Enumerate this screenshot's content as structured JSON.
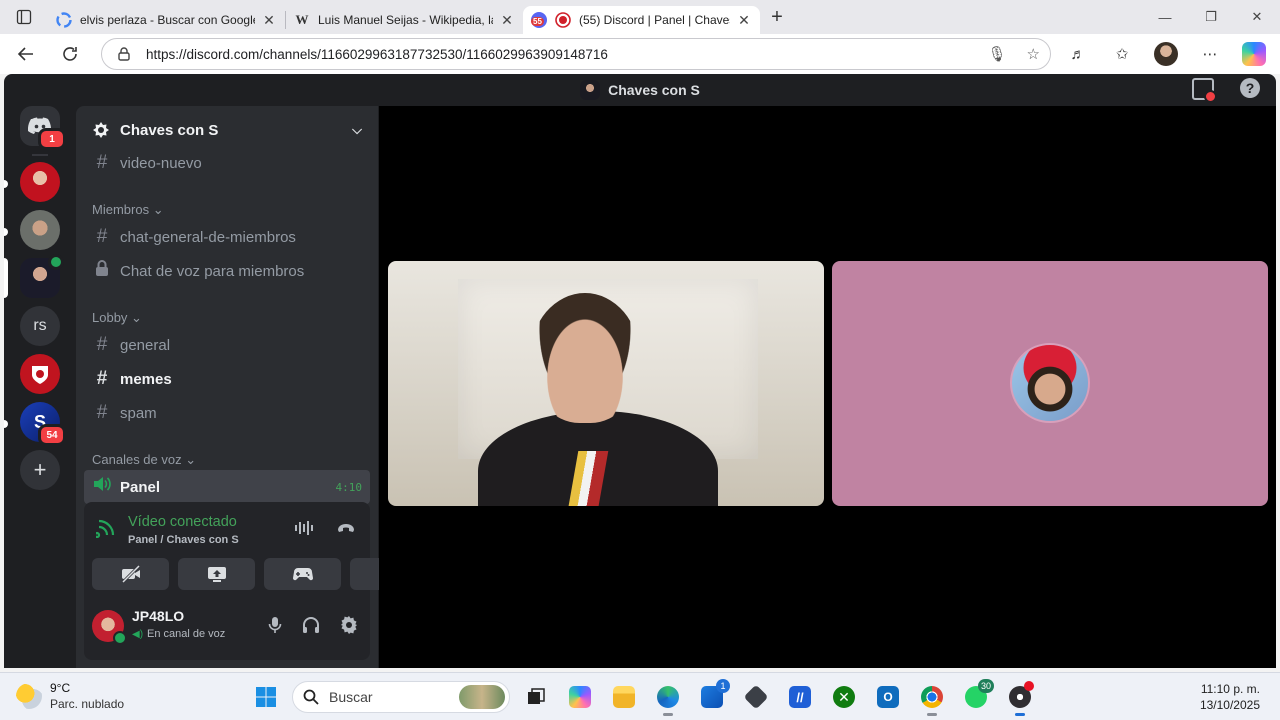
{
  "browser": {
    "tabs": [
      {
        "title": "elvis perlaza - Buscar con Google",
        "favicon": "google-icon",
        "active": false
      },
      {
        "title": "Luis Manuel Seijas - Wikipedia, la",
        "favicon": "wikipedia-icon",
        "active": false
      },
      {
        "title": "(55) Discord | Panel | Chaves",
        "favicon": "discord-icon",
        "badge": "55",
        "recording": true,
        "active": true
      }
    ],
    "url": "https://discord.com/channels/1166029963187732530/1166029963909148716"
  },
  "discord": {
    "window_title": "Chaves con S",
    "rail": {
      "home_badge": "1",
      "text_server_label": "rs",
      "server_badge": "54"
    },
    "server": {
      "name": "Chaves con S"
    },
    "channels": {
      "top": {
        "name": "video-nuevo"
      },
      "categories": [
        {
          "name": "Miembros",
          "items": [
            {
              "name": "chat-general-de-miembros",
              "type": "text"
            },
            {
              "name": "Chat de voz para miembros",
              "type": "locked-voice"
            }
          ]
        },
        {
          "name": "Lobby",
          "items": [
            {
              "name": "general",
              "type": "text"
            },
            {
              "name": "memes",
              "type": "text",
              "unread": true
            },
            {
              "name": "spam",
              "type": "text"
            }
          ]
        },
        {
          "name": "Canales de voz",
          "items": [
            {
              "name": "Panel",
              "type": "voice",
              "active": true,
              "duration": "4:10"
            }
          ]
        }
      ]
    },
    "voice_panel": {
      "status": "Vídeo conectado",
      "location": "Panel / Chaves con S"
    },
    "user": {
      "name": "JP48LO",
      "status": "En canal de voz"
    },
    "colors": {
      "accent_green": "#23a55a",
      "bg_dark": "#1e1f22",
      "avatar_tile": "#c083a2"
    }
  },
  "taskbar": {
    "weather_temp": "9°C",
    "weather_desc": "Parc. nublado",
    "search_placeholder": "Buscar",
    "store_badge": "1",
    "whatsapp_badge": "30",
    "time": "11:10 p. m.",
    "date": "13/10/2025"
  }
}
